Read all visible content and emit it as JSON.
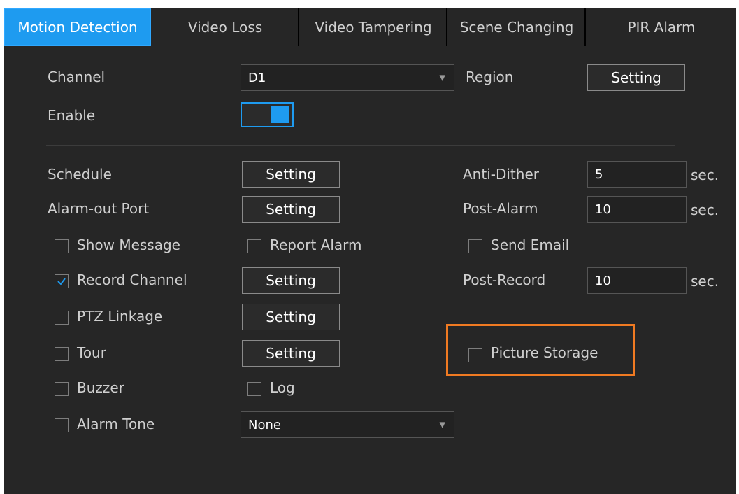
{
  "tabs": [
    {
      "label": "Motion Detection",
      "active": true
    },
    {
      "label": "Video Loss"
    },
    {
      "label": "Video Tampering"
    },
    {
      "label": "Scene Changing"
    },
    {
      "label": "PIR Alarm"
    }
  ],
  "form": {
    "channel_label": "Channel",
    "channel_value": "D1",
    "region_label": "Region",
    "region_button": "Setting",
    "enable_label": "Enable",
    "enable_on": true,
    "schedule_label": "Schedule",
    "schedule_button": "Setting",
    "anti_dither_label": "Anti-Dither",
    "anti_dither_value": "5",
    "anti_dither_unit": "sec.",
    "alarm_out_label": "Alarm-out Port",
    "alarm_out_button": "Setting",
    "post_alarm_label": "Post-Alarm",
    "post_alarm_value": "10",
    "post_alarm_unit": "sec.",
    "show_message_label": "Show Message",
    "show_message_checked": false,
    "report_alarm_label": "Report Alarm",
    "report_alarm_checked": false,
    "send_email_label": "Send Email",
    "send_email_checked": false,
    "record_channel_label": "Record Channel",
    "record_channel_checked": true,
    "record_channel_button": "Setting",
    "post_record_label": "Post-Record",
    "post_record_value": "10",
    "post_record_unit": "sec.",
    "ptz_label": "PTZ Linkage",
    "ptz_checked": false,
    "ptz_button": "Setting",
    "tour_label": "Tour",
    "tour_checked": false,
    "tour_button": "Setting",
    "picture_storage_label": "Picture Storage",
    "picture_storage_checked": false,
    "buzzer_label": "Buzzer",
    "buzzer_checked": false,
    "log_label": "Log",
    "log_checked": false,
    "alarm_tone_label": "Alarm Tone",
    "alarm_tone_checked": false,
    "alarm_tone_value": "None"
  },
  "colors": {
    "accent": "#1e9bf0",
    "highlight": "#f07a22",
    "background": "#262626"
  }
}
